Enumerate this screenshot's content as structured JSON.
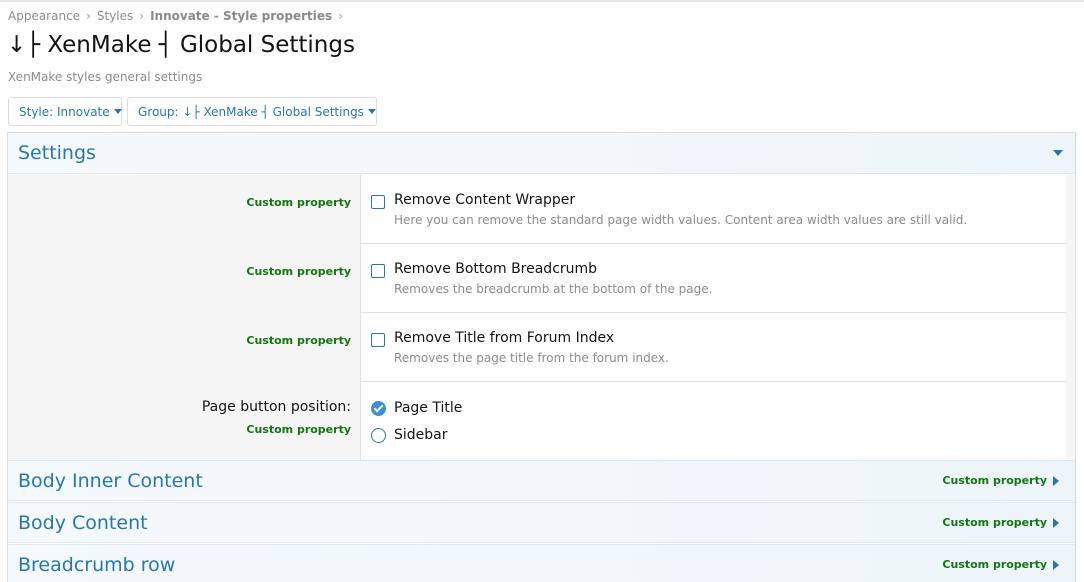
{
  "breadcrumb": {
    "items": [
      "Appearance",
      "Styles",
      "Innovate - Style properties"
    ],
    "separator": "›"
  },
  "page": {
    "title": "↓├ XenMake ┤ Global Settings",
    "description": "XenMake styles general settings"
  },
  "filters": {
    "style_label": "Style: Innovate",
    "group_label": "Group: ↓├ XenMake ┤ Global Settings"
  },
  "sections": {
    "settings": {
      "title": "Settings",
      "expanded": true,
      "properties": [
        {
          "tag": "Custom property",
          "label": "Remove Content Wrapper",
          "hint": "Here you can remove the standard page width values. Content area width values are still valid.",
          "checked": false
        },
        {
          "tag": "Custom property",
          "label": "Remove Bottom Breadcrumb",
          "hint": "Removes the breadcrumb at the bottom of the page.",
          "checked": false
        },
        {
          "tag": "Custom property",
          "label": "Remove Title from Forum Index",
          "hint": "Removes the page title from the forum index.",
          "checked": false
        }
      ],
      "page_button": {
        "label": "Page button position:",
        "tag": "Custom property",
        "options": [
          "Page Title",
          "Sidebar"
        ],
        "selected": "Page Title"
      }
    },
    "collapsed": [
      {
        "title": "Body Inner Content",
        "tag": "Custom property"
      },
      {
        "title": "Body Content",
        "tag": "Custom property"
      },
      {
        "title": "Breadcrumb row",
        "tag": "Custom property"
      }
    ]
  },
  "colors": {
    "link": "#2577b1",
    "custom_property": "#127712",
    "muted_text": "#8c8c8c",
    "radio_checked": "#3d8fd1"
  }
}
